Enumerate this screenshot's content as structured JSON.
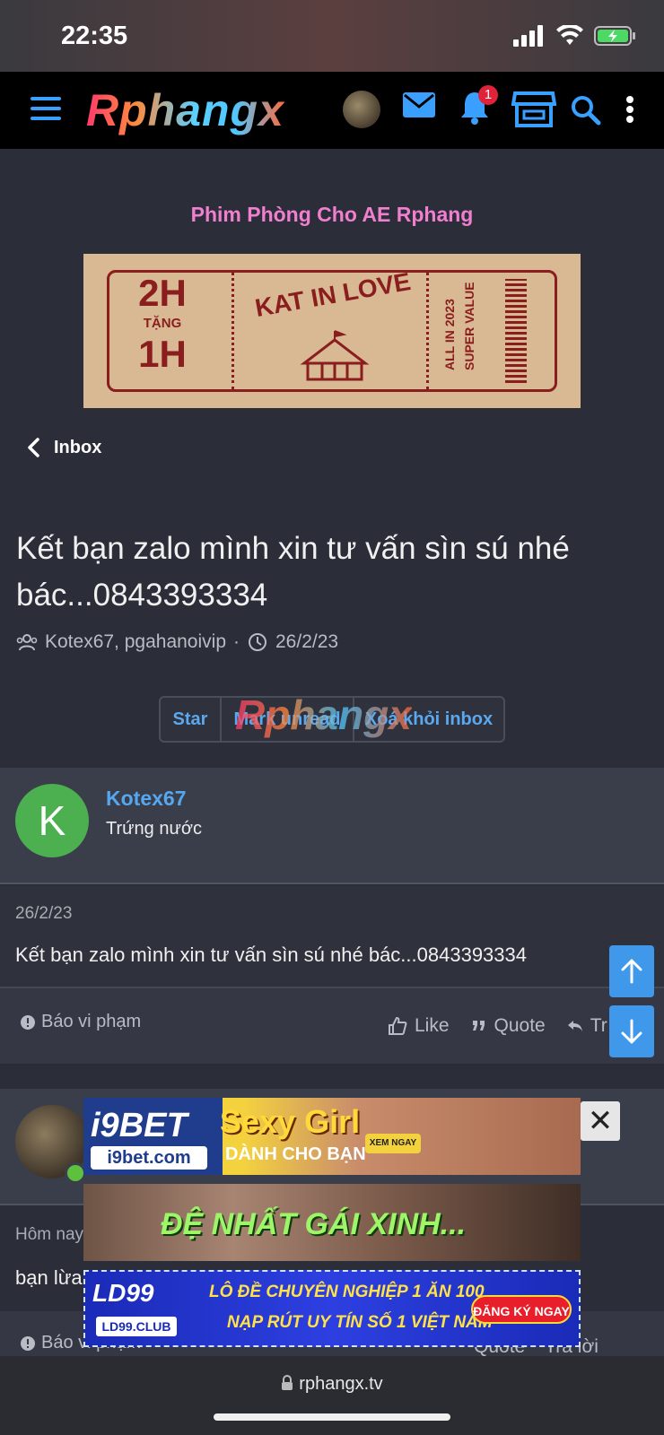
{
  "status_bar": {
    "time": "22:35"
  },
  "header": {
    "logo": "Rphangx",
    "notification_count": "1"
  },
  "promo": {
    "title": "Phim Phòng Cho AE Rphang",
    "ticket": {
      "line1": "2H",
      "line2": "TẶNG",
      "line3": "1H",
      "center": "KAT IN LOVE",
      "side1": "ALL IN 2023",
      "side2": "SUPER VALUE"
    }
  },
  "nav": {
    "back_label": "Inbox"
  },
  "thread": {
    "title": "Kết bạn zalo mình xin tư vấn sìn sú nhé bác...0843393334",
    "participants": "Kotex67, pgahanoivip",
    "separator": "·",
    "date": "26/2/23"
  },
  "actions": {
    "star": "Star",
    "mark_unread": "Mark unread",
    "remove": "Xoá khỏi inbox"
  },
  "watermark": "Rphangx",
  "messages": [
    {
      "avatar_letter": "K",
      "author": "Kotex67",
      "role": "Trứng nước",
      "date": "26/2/23",
      "text": "Kết bạn zalo mình xin tư vấn sìn sú nhé bác...0843393334",
      "report": "Báo vi phạm",
      "like": "Like",
      "quote": "Quote",
      "reply": "Tr"
    },
    {
      "date": "Hôm nay",
      "text": "bạn lừa",
      "report": "Báo vi phạm",
      "quote": "Quote",
      "reply": "Trả lời"
    }
  ],
  "ads": {
    "ad1": {
      "logo": "i9BET",
      "domain": "i9bet.com",
      "headline": "Sexy Girl",
      "sub": "DÀNH CHO BẠN",
      "cta": "XEM NGAY"
    },
    "ad2": {
      "headline": "ĐỆ NHẤT GÁI XINH..."
    },
    "ad3": {
      "logo": "LD99",
      "domain": "LD99.CLUB",
      "line1": "LÔ ĐỀ CHUYÊN NGHIỆP 1 ĂN 100",
      "line2": "NẠP RÚT UY TÍN SỐ 1 VIỆT NAM",
      "cta": "ĐĂNG KÝ NGAY"
    },
    "close": "✕"
  },
  "browser": {
    "url": "rphangx.tv"
  },
  "colors": {
    "accent": "#3f98ea",
    "link": "#55a8f0",
    "promo": "#f07fd0",
    "avatar": "#4caf50",
    "badge": "#e0223a"
  }
}
